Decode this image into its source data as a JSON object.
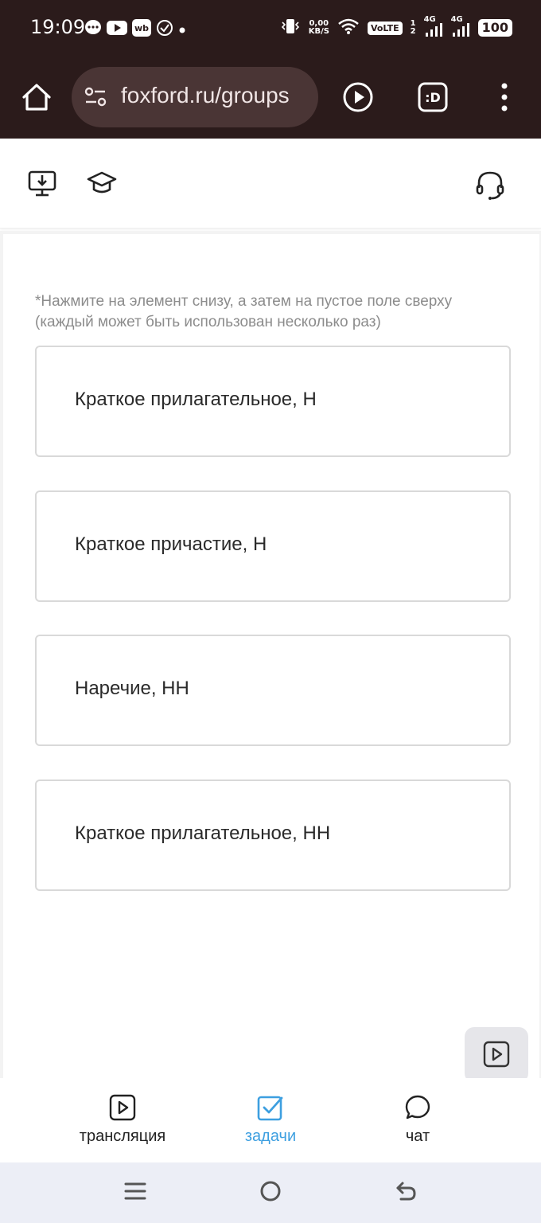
{
  "status_bar": {
    "time": "19:09",
    "net_speed_value": "0,00",
    "net_speed_unit": "KB/S",
    "volte": "VoLTE",
    "sim1_label": "4G",
    "sim1_sub": "1",
    "sim2_sub": "2",
    "sim2_label": "4G",
    "battery": "100"
  },
  "browser": {
    "url": "foxford.ru/groups"
  },
  "task": {
    "hint": "*Нажмите на элемент снизу, а затем на пустое поле сверху (каждый может быть использован несколько раз)",
    "options": [
      "Краткое прилагательное, Н",
      "Краткое причастие, Н",
      "Наречие, НН",
      "Краткое прилагательное, НН"
    ]
  },
  "bottom_nav": {
    "items": [
      {
        "label": "трансляция"
      },
      {
        "label": "задачи"
      },
      {
        "label": "чат"
      }
    ],
    "active_color": "#3d9fe0"
  }
}
